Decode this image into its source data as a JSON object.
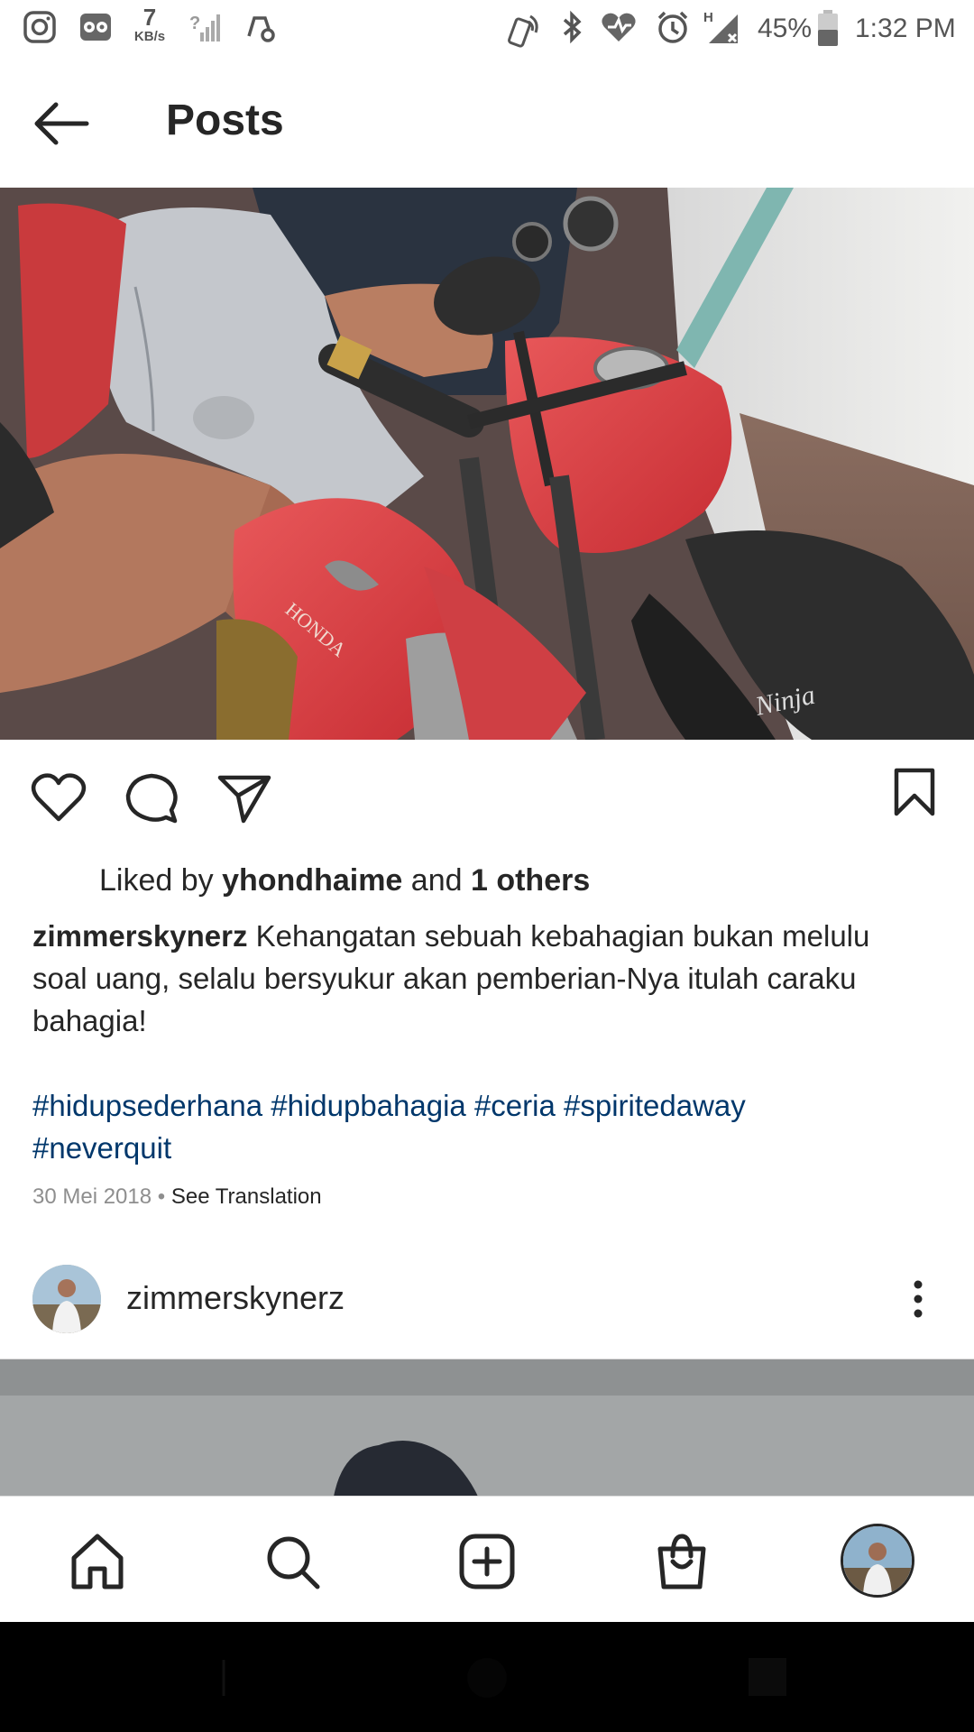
{
  "status_bar": {
    "network_speed_value": "7",
    "network_speed_unit": "KB/s",
    "battery": "45%",
    "time": "1:32 PM"
  },
  "header": {
    "title": "Posts"
  },
  "post": {
    "liked_by_prefix": "Liked by",
    "liked_by_user": "yhondhaime",
    "liked_by_mid": "and",
    "liked_by_others": "1 others",
    "caption_username": "zimmerskynerz",
    "caption_text": "Kehangatan sebuah kebahagian bukan melulu soal uang, selalu bersyukur akan pemberian-Nya itulah caraku bahagia!",
    "hashtags": [
      "#hidupsederhana",
      "#hidupbahagia",
      "#ceria",
      "#spiritedaway",
      "#neverquit"
    ],
    "date": "30 Mei 2018",
    "separator": "•",
    "see_translation": "See Translation"
  },
  "next_post": {
    "username": "zimmerskynerz"
  },
  "icons": {
    "back": "arrow-left-icon",
    "like": "heart-icon",
    "comment": "comment-icon",
    "share": "paper-plane-icon",
    "save": "bookmark-icon",
    "more": "kebab-menu-icon",
    "home": "home-icon",
    "search": "search-icon",
    "create": "plus-square-icon",
    "shop": "shopping-bag-icon"
  },
  "colors": {
    "text": "#262626",
    "hashtag": "#00376b",
    "muted": "#8e8e8e",
    "divider": "#dbdbdb"
  }
}
